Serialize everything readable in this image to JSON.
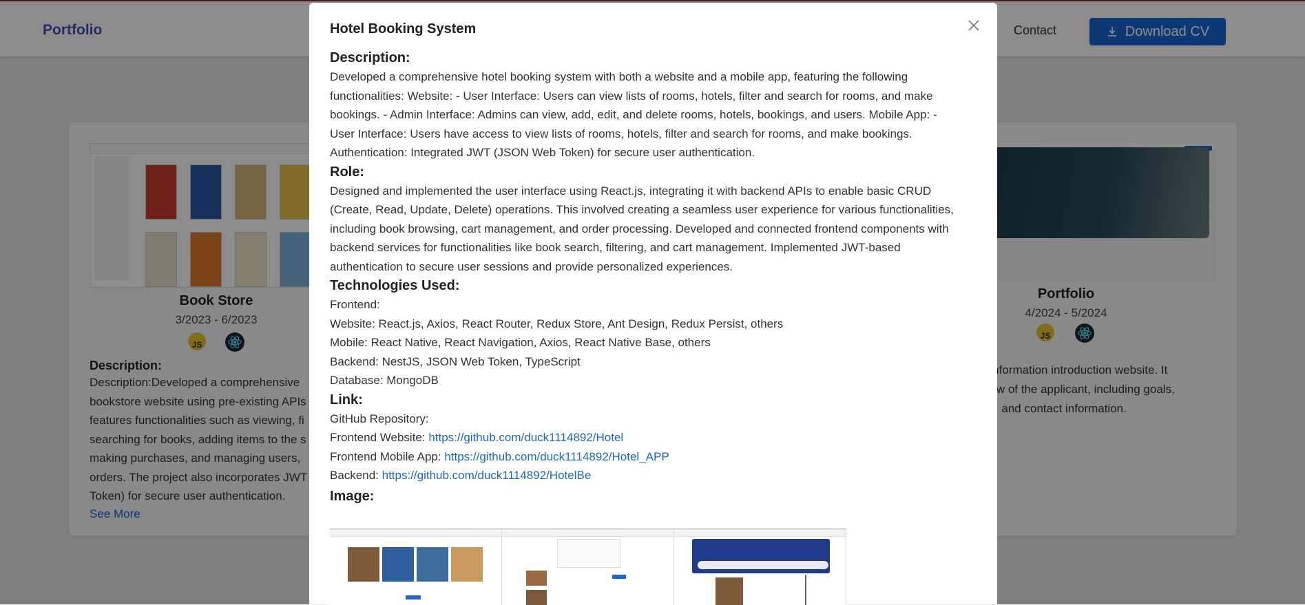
{
  "nav": {
    "brand": "Portfolio",
    "contact": "Contact",
    "download_cv": "Download CV"
  },
  "cards": {
    "left": {
      "title": "Book Store",
      "date": "3/2023 - 6/2023",
      "tech": [
        "JS",
        "React"
      ],
      "desc_heading": "Description:",
      "desc_lines": [
        "Description:Developed a comprehensive",
        "bookstore website using pre-existing APIs",
        "features functionalities such as viewing, fi",
        "searching for books, adding items to the s",
        "making purchases, and managing users,",
        "orders. The project also incorporates JWT",
        "Token) for secure user authentication."
      ],
      "see_more": "See More"
    },
    "right": {
      "title": "Portfolio",
      "date": "4/2024 - 5/2024",
      "tech": [
        "JS",
        "React"
      ],
      "desc_lines": [
        "nal information introduction website. It",
        "erview of the applicant, including goals,",
        "jects, and contact information."
      ]
    }
  },
  "modal": {
    "title": "Hotel Booking System",
    "description_heading": "Description:",
    "description_lines": [
      "Developed a comprehensive hotel booking system with both a website and a mobile app, featuring the following",
      "functionalities: Website: - User Interface: Users can view lists of rooms, hotels, filter and search for rooms, and make",
      "bookings. - Admin Interface: Admins can view, add, edit, and delete rooms, hotels, bookings, and users. Mobile App: -",
      "User Interface: Users have access to view lists of rooms, hotels, filter and search for rooms, and make bookings.",
      "Authentication: Integrated JWT (JSON Web Token) for secure user authentication."
    ],
    "role_heading": "Role:",
    "role_lines": [
      "Designed and implemented the user interface using React.js, integrating it with backend APIs to enable basic CRUD",
      "(Create, Read, Update, Delete) operations. This involved creating a seamless user experience for various functionalities,",
      "including book browsing, cart management, and order processing. Developed and connected frontend components with",
      "backend services for functionalities like book search, filtering, and cart management. Implemented JWT-based",
      "authentication to secure user sessions and provide personalized experiences."
    ],
    "tech_heading": "Technologies Used:",
    "tech_lines": [
      "Frontend:",
      "Website: React.js, Axios, React Router, Redux Store, Ant Design, Redux Persist, others",
      "Mobile: React Native, React Navigation, Axios, React Native Base, others",
      "Backend: NestJS, JSON Web Token, TypeScript",
      "Database: MongoDB"
    ],
    "link_heading": "Link:",
    "links": {
      "repo_label": "GitHub Repository:",
      "website_label": "Frontend Website: ",
      "website_url": "https://github.com/duck1114892/Hotel",
      "mobile_label": "Frontend Mobile App: ",
      "mobile_url": "https://github.com/duck1114892/Hotel_APP",
      "backend_label": "Backend: ",
      "backend_url": "https://github.com/duck1114892/HotelBe"
    },
    "image_heading": "Image:"
  },
  "colors": {
    "accent": "#1a66d6",
    "brand": "#3f51b5",
    "overlay": "rgba(0,0,0,0.45)"
  },
  "icons": {
    "close": "close-icon",
    "download": "download-icon",
    "js": "javascript-icon",
    "react": "react-icon"
  }
}
